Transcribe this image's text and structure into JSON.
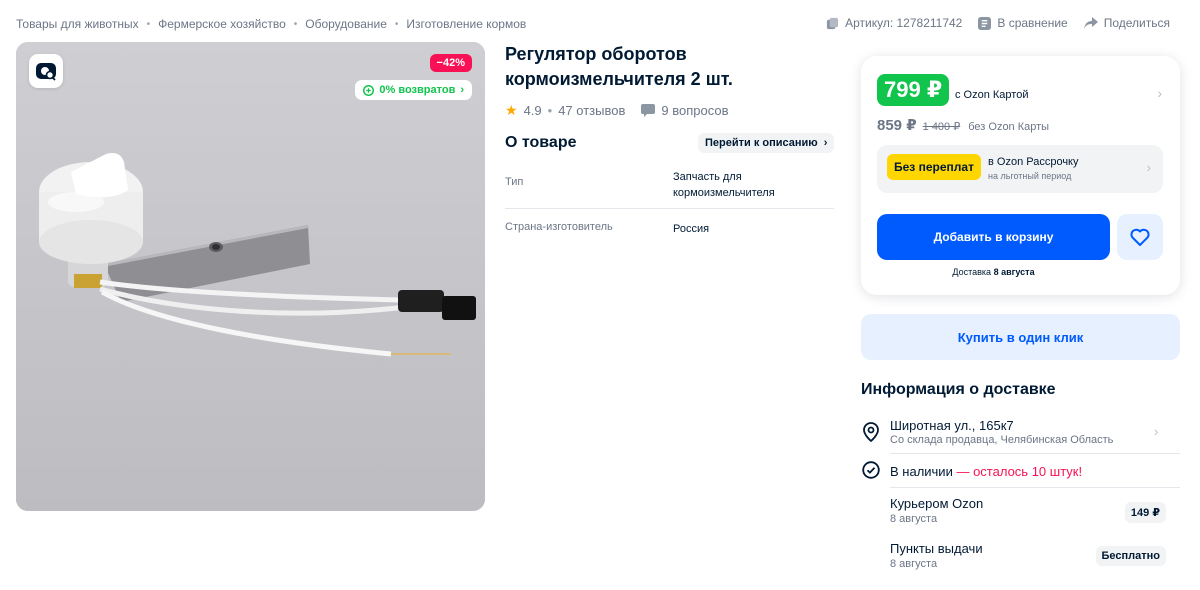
{
  "breadcrumbs": [
    "Товары для животных",
    "Фермерское хозяйство",
    "Оборудование",
    "Изготовление кормов"
  ],
  "top_actions": {
    "article": "Артикул: 1278211742",
    "compare": "В сравнение",
    "share": "Поделиться"
  },
  "gallery": {
    "discount": "−42%",
    "returns": "0% возвратов"
  },
  "product": {
    "title": "Регулятор оборотов кормоизмельчителя 2 шт.",
    "rating": "4.9",
    "reviews": "47 отзывов",
    "questions": "9 вопросов"
  },
  "about": {
    "title": "О товаре",
    "goto": "Перейти к описанию",
    "specs": [
      {
        "key": "Тип",
        "value": "Запчасть для кормоизмельчителя"
      },
      {
        "key": "Страна-изготовитель",
        "value": "Россия"
      }
    ]
  },
  "price": {
    "card_price": "799 ₽",
    "card_label": "с Ozon Картой",
    "regular_price": "859 ₽",
    "old_price": "1 400 ₽",
    "regular_label": "без Ozon Карты",
    "installment_badge": "Без переплат",
    "installment_title": "в Ozon Рассрочку",
    "installment_sub": "на льготный период",
    "add_to_cart": "Добавить в корзину",
    "delivery_prefix": "Доставка",
    "delivery_date": "8 августа"
  },
  "one_click": "Купить в один клик",
  "delivery": {
    "title": "Информация о доставке",
    "address": "Широтная ул., 165к7",
    "address_sub": "Со склада продавца, Челябинская Область",
    "stock": "В наличии",
    "stock_warn": "— осталось 10 штук!",
    "options": [
      {
        "name": "Курьером Ozon",
        "date": "8 августа",
        "price": "149 ₽"
      },
      {
        "name": "Пункты выдачи",
        "date": "8 августа",
        "price": "Бесплатно"
      }
    ]
  },
  "colors": {
    "accent": "#005bff",
    "green": "#10c44c",
    "discount": "#f91155",
    "installment": "#ffd600"
  }
}
